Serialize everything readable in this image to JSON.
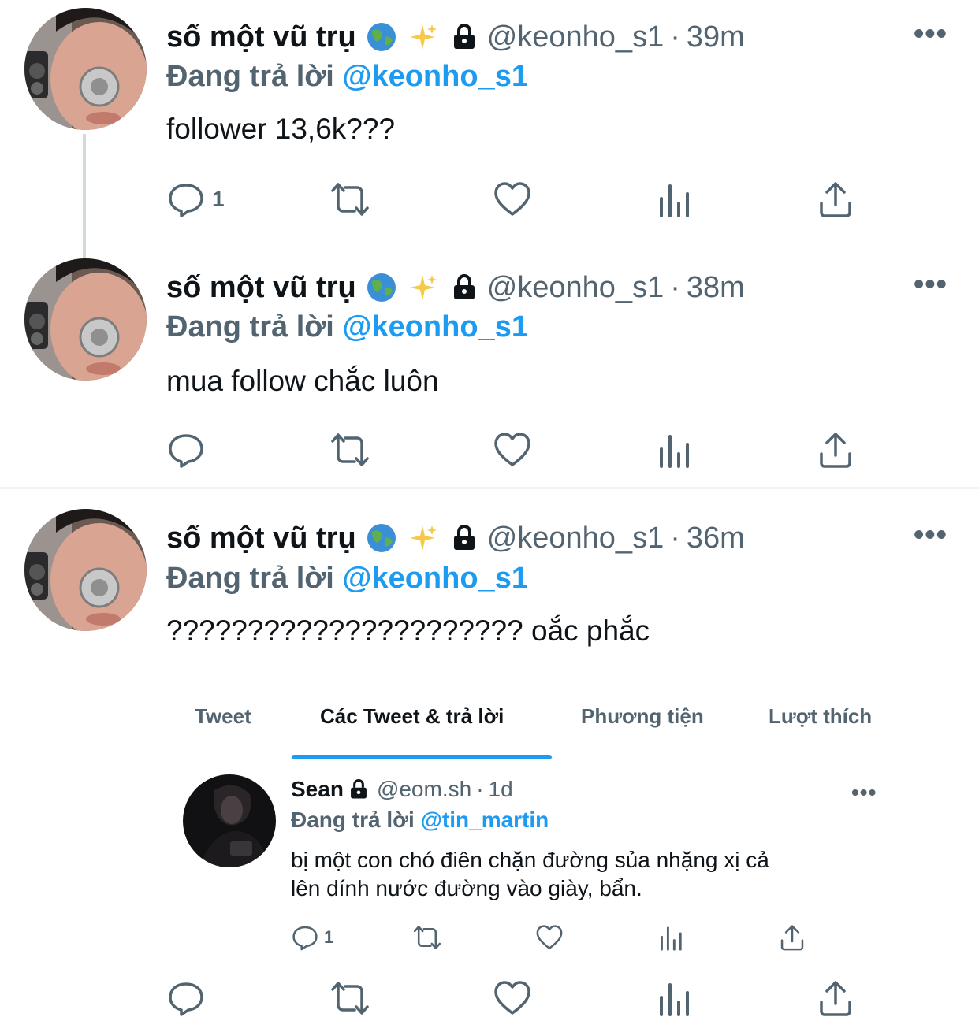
{
  "tweets": [
    {
      "display_name": "số một vũ trụ",
      "emoji1": "🌏",
      "emoji2": "✨",
      "handle": "@keonho_s1",
      "separator": "·",
      "time": "39m",
      "reply_prefix": "Đang trả lời",
      "reply_to": "@keonho_s1",
      "text": "follower 13,6k???",
      "reply_count": "1"
    },
    {
      "display_name": "số một vũ trụ",
      "emoji1": "🌏",
      "emoji2": "✨",
      "handle": "@keonho_s1",
      "separator": "·",
      "time": "38m",
      "reply_prefix": "Đang trả lời",
      "reply_to": "@keonho_s1",
      "text": "mua follow chắc luôn",
      "reply_count": ""
    },
    {
      "display_name": "số một vũ trụ",
      "emoji1": "🌏",
      "emoji2": "✨",
      "handle": "@keonho_s1",
      "separator": "·",
      "time": "36m",
      "reply_prefix": "Đang trả lời",
      "reply_to": "@keonho_s1",
      "text": "?????????????????????? oắc phắc",
      "reply_count": ""
    }
  ],
  "more_label": "•••",
  "tabs": [
    {
      "label": "Tweet"
    },
    {
      "label": "Các Tweet & trả lời"
    },
    {
      "label": "Phương tiện"
    },
    {
      "label": "Lượt thích"
    }
  ],
  "embedded": {
    "display_name": "Sean",
    "handle": "@eom.sh",
    "separator": "·",
    "time": "1d",
    "reply_prefix": "Đang trả lời",
    "reply_to": "@tin_martin",
    "text_line1": "bị một con chó điên chặn đường sủa nhặng xị cả",
    "text_line2": "lên dính nước đường vào giày, bẩn.",
    "reply_count": "1"
  },
  "colors": {
    "accent": "#1d9bf0",
    "secondary_text": "#536471",
    "primary_text": "#0f1419"
  }
}
